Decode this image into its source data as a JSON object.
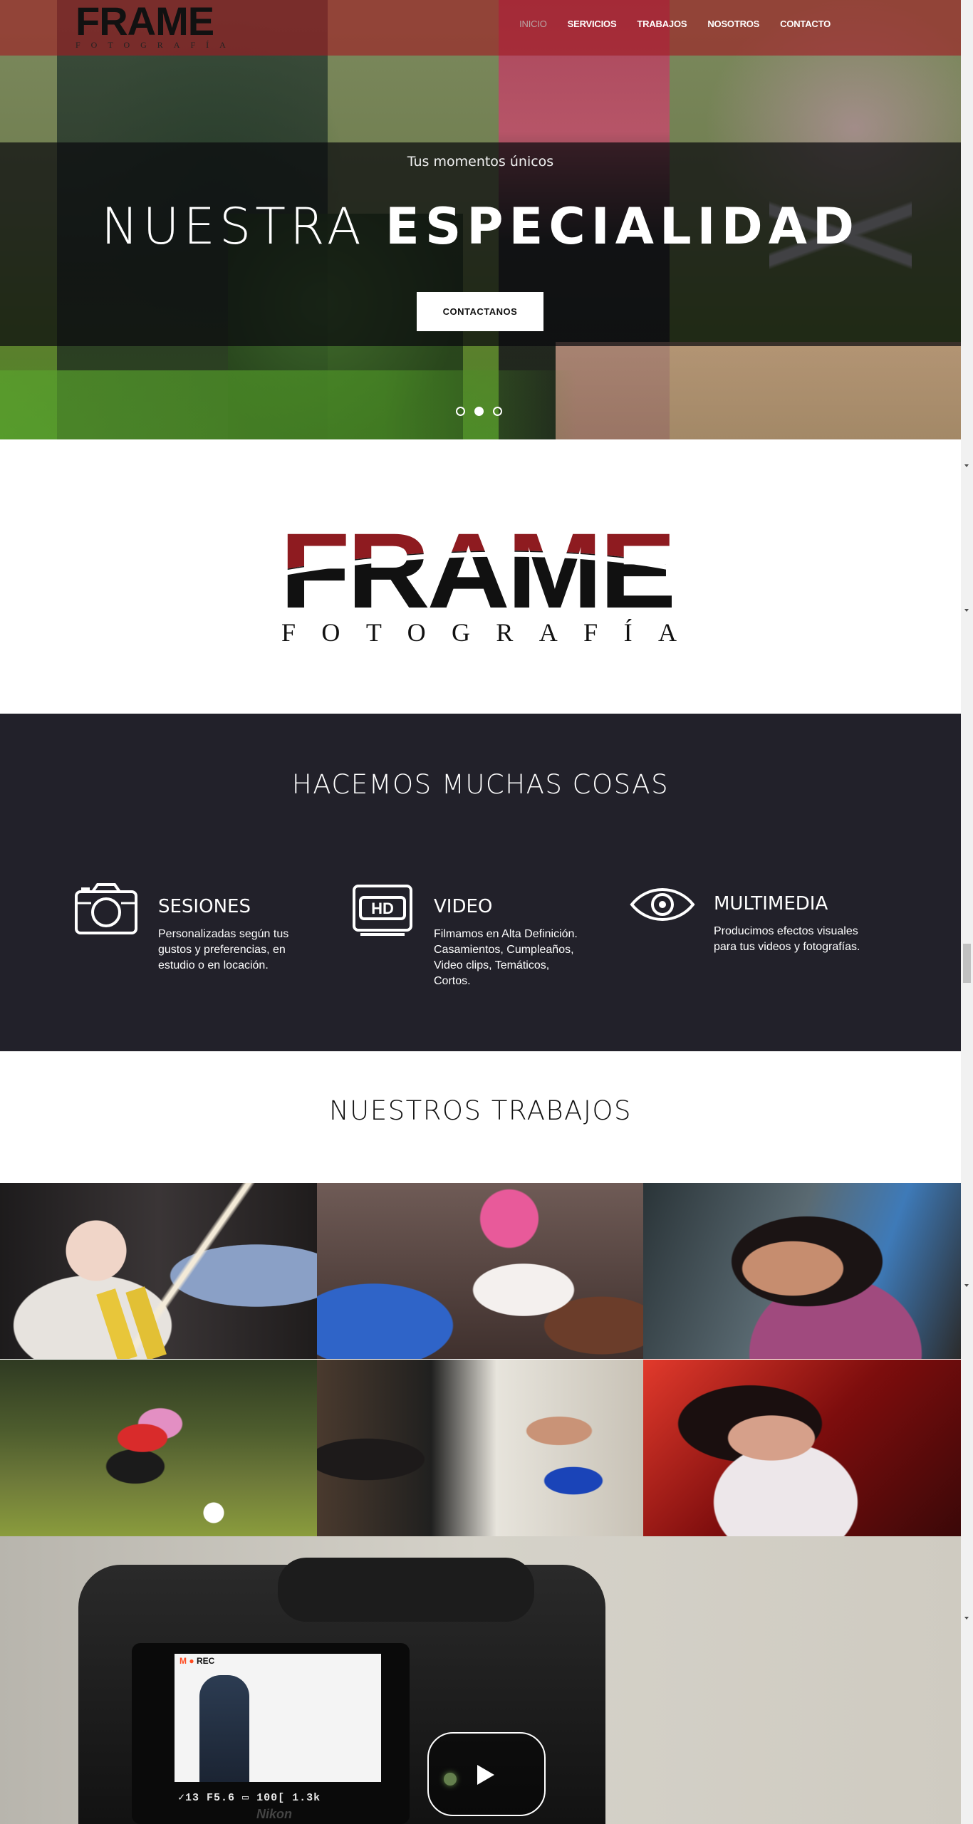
{
  "brand": {
    "name": "FRAME",
    "tagline": "FOTOGRAFÍA",
    "color_red": "#8e1b20",
    "color_dark": "#111111"
  },
  "nav": {
    "items": [
      {
        "label": "INICIO",
        "active": true
      },
      {
        "label": "SERVICIOS",
        "active": false
      },
      {
        "label": "TRABAJOS",
        "active": false
      },
      {
        "label": "NOSOTROS",
        "active": false
      },
      {
        "label": "CONTACTO",
        "active": false
      }
    ],
    "bar_color": "#a01a22"
  },
  "hero": {
    "subtitle": "Tus momentos únicos",
    "title_light": "NUESTRA",
    "title_bold": "ESPECIALIDAD",
    "cta_label": "CONTACTANOS",
    "slides": 3,
    "active_slide": 2
  },
  "services": {
    "title": "HACEMOS MUCHAS COSAS",
    "items": [
      {
        "icon": "camera-icon",
        "title": "SESIONES",
        "description": "Personalizadas según tus gustos y preferencias, en estudio o en locación."
      },
      {
        "icon": "hd-video-icon",
        "title": "VIDEO",
        "description": "Filmamos en Alta Definición. Casamientos, Cumpleaños, Video clips, Temáticos, Cortos."
      },
      {
        "icon": "eye-icon",
        "title": "MULTIMEDIA",
        "description": "Producimos efectos visuales para tus videos y fotografías."
      }
    ],
    "background": "#22212a"
  },
  "works": {
    "title": "NUESTROS TRABAJOS",
    "gallery": [
      {
        "subject": "baby-with-candles"
      },
      {
        "subject": "party-celebration"
      },
      {
        "subject": "woman-portrait"
      },
      {
        "subject": "soccer-players"
      },
      {
        "subject": "birthday-cake"
      },
      {
        "subject": "singer-on-stage"
      }
    ]
  },
  "video": {
    "rec_text": "REC",
    "mode_text": "M",
    "status_text": "✓13  F5.6  ▭  100[  1.3k",
    "camera_brand": "Nikon",
    "play_icon": "play-icon"
  }
}
